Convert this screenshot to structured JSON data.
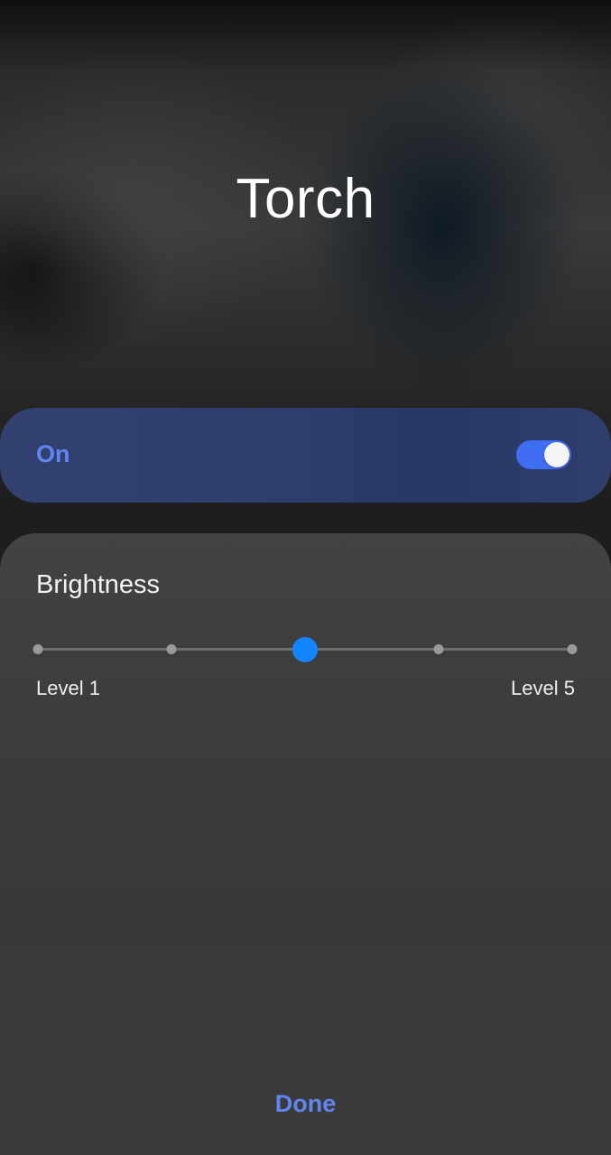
{
  "header": {
    "title": "Torch"
  },
  "toggle": {
    "label": "On",
    "state": "on",
    "accent_color": "#5f86ef",
    "switch_color": "#3f6ef2"
  },
  "brightness": {
    "label": "Brightness",
    "min_label": "Level 1",
    "max_label": "Level 5",
    "levels": 5,
    "current_level": 3,
    "thumb_color": "#1386ff"
  },
  "footer": {
    "done_label": "Done"
  }
}
